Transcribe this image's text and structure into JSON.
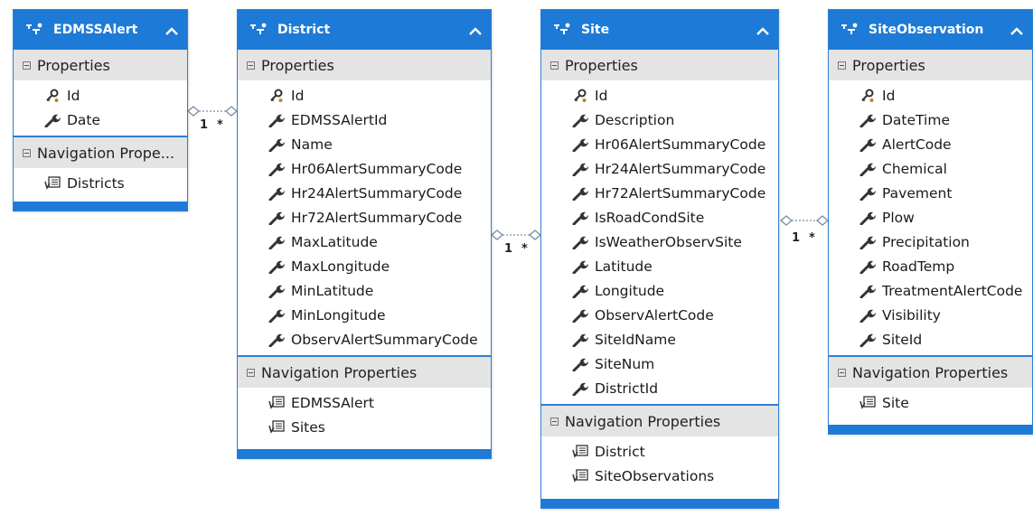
{
  "entities": {
    "edmss": {
      "title": "EDMSSAlert",
      "properties_label": "Properties",
      "properties": [
        "Id",
        "Date"
      ],
      "key_property": "Id",
      "nav_label": "Navigation Prope...",
      "nav_properties": [
        "Districts"
      ]
    },
    "district": {
      "title": "District",
      "properties_label": "Properties",
      "properties": [
        "Id",
        "EDMSSAlertId",
        "Name",
        "Hr06AlertSummaryCode",
        "Hr24AlertSummaryCode",
        "Hr72AlertSummaryCode",
        "MaxLatitude",
        "MaxLongitude",
        "MinLatitude",
        "MinLongitude",
        "ObservAlertSummaryCode"
      ],
      "key_property": "Id",
      "nav_label": "Navigation Properties",
      "nav_properties": [
        "EDMSSAlert",
        "Sites"
      ]
    },
    "site": {
      "title": "Site",
      "properties_label": "Properties",
      "properties": [
        "Id",
        "Description",
        "Hr06AlertSummaryCode",
        "Hr24AlertSummaryCode",
        "Hr72AlertSummaryCode",
        "IsRoadCondSite",
        "IsWeatherObservSite",
        "Latitude",
        "Longitude",
        "ObservAlertCode",
        "SiteIdName",
        "SiteNum",
        "DistrictId"
      ],
      "key_property": "Id",
      "nav_label": "Navigation Properties",
      "nav_properties": [
        "District",
        "SiteObservations"
      ]
    },
    "siteobs": {
      "title": "SiteObservation",
      "properties_label": "Properties",
      "properties": [
        "Id",
        "DateTime",
        "AlertCode",
        "Chemical",
        "Pavement",
        "Plow",
        "Precipitation",
        "RoadTemp",
        "TreatmentAlertCode",
        "Visibility",
        "SiteId"
      ],
      "key_property": "Id",
      "nav_label": "Navigation Properties",
      "nav_properties": [
        "Site"
      ]
    }
  },
  "associations": [
    {
      "from": "EDMSSAlert",
      "to": "District",
      "from_mult": "1",
      "to_mult": "*"
    },
    {
      "from": "District",
      "to": "Site",
      "from_mult": "1",
      "to_mult": "*"
    },
    {
      "from": "Site",
      "to": "SiteObservation",
      "from_mult": "1",
      "to_mult": "*"
    }
  ],
  "colors": {
    "header": "#1e7ad7",
    "border": "#2f7fd0",
    "section": "#e4e4e4",
    "connector": "#7a8ea5"
  },
  "icons": {
    "entity": "entity-type-icon",
    "key": "key-property-icon",
    "property": "wrench-property-icon",
    "navigation": "navigation-property-icon",
    "collapse": "chevron-up-icon",
    "section_toggle": "minus-box-icon"
  }
}
